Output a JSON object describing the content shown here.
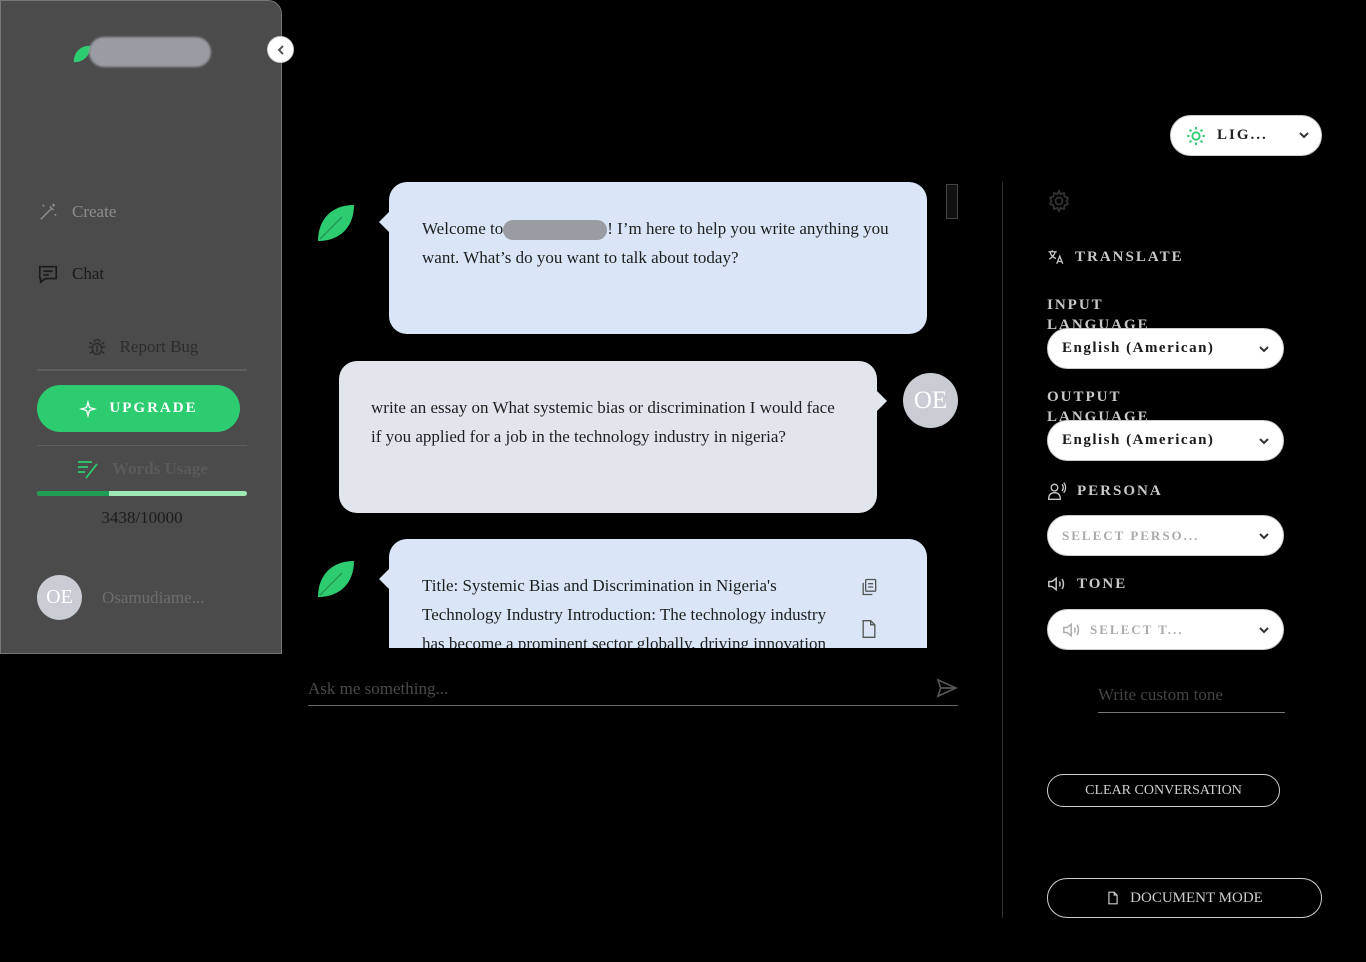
{
  "colors": {
    "accent": "#2ecc71",
    "sidebar_bg": "#4b4b4b",
    "bot_bubble": "#dae6f8",
    "user_bubble": "#e1e6ed",
    "background": "#000000"
  },
  "sidebar": {
    "nav": [
      {
        "label": "Create",
        "icon": "magic-pen-icon"
      },
      {
        "label": "Chat",
        "icon": "chat-icon"
      }
    ],
    "report_bug": "Report Bug",
    "upgrade": "UPGRADE",
    "words_usage": {
      "label": "Words Usage",
      "count_text": "3438/10000",
      "used": 3438,
      "total": 10000
    },
    "user": {
      "initials": "OE",
      "name": "Osamudiame..."
    }
  },
  "theme": {
    "label": "LIG..."
  },
  "chat": {
    "messages": [
      {
        "role": "assistant",
        "text_before": "Welcome to",
        "text_after": "! I’m here to help you write anything you want. What’s do you want to talk about today?"
      },
      {
        "role": "user",
        "initials": "OE",
        "text": "write an essay on What systemic bias or discrimination I would face if you applied for a job in the technology industry in nigeria?"
      },
      {
        "role": "assistant",
        "text": "Title: Systemic Bias and Discrimination in Nigeria's Technology Industry Introduction: The technology industry has become a prominent sector globally, driving innovation"
      }
    ],
    "input_placeholder": "Ask me something..."
  },
  "panel": {
    "translate": "TRANSLATE",
    "input_language_label": "INPUT LANGUAGE",
    "input_language": "English (American)",
    "output_language_label": "OUTPUT LANGUAGE",
    "output_language": "English (American)",
    "persona": "PERSONA",
    "persona_placeholder": "SELECT PERSO...",
    "tone": "TONE",
    "tone_placeholder": "SELECT T...",
    "custom_tone_placeholder": "Write custom tone",
    "clear": "CLEAR CONVERSATION",
    "document_mode": "DOCUMENT MODE"
  }
}
